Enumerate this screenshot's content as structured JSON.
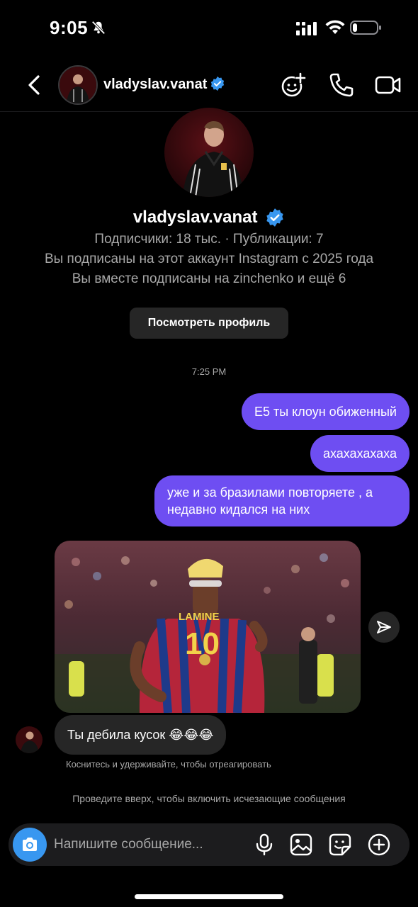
{
  "status_bar": {
    "time": "9:05",
    "battery_level": 0.2
  },
  "header": {
    "username": "vladyslav.vanat",
    "verified": true
  },
  "profile": {
    "username": "vladyslav.vanat",
    "stats": "Подписчики: 18 тыс. · Публикации: 7",
    "followed_since": "Вы подписаны на этот аккаунт Instagram с 2025 года",
    "mutual": "Вы вместе подписаны на zinchenko и ещё 6",
    "view_profile_label": "Посмотреть профиль"
  },
  "conversation": {
    "timestamp": "7:25 PM",
    "outgoing": [
      {
        "text": "Е5 ты клоун обиженный"
      },
      {
        "text": "ахахахахаха"
      },
      {
        "line1": "уже и за бразилами повторяете , а",
        "line2": "недавно кидался на них"
      }
    ],
    "incoming": {
      "image": "football-player-photo",
      "text": "Ты дебила кусок 😂😂😂",
      "reaction_hint": "Коснитесь и удерживайте, чтобы отреагировать"
    },
    "swipe_hint": "Проведите вверх, чтобы включить исчезающие сообщения"
  },
  "composer": {
    "placeholder": "Напишите сообщение..."
  },
  "colors": {
    "outgoing_bubble": "#6e4ef2",
    "incoming_bubble": "#262626",
    "verified": "#3897f0",
    "camera_button": "#3897f0"
  }
}
